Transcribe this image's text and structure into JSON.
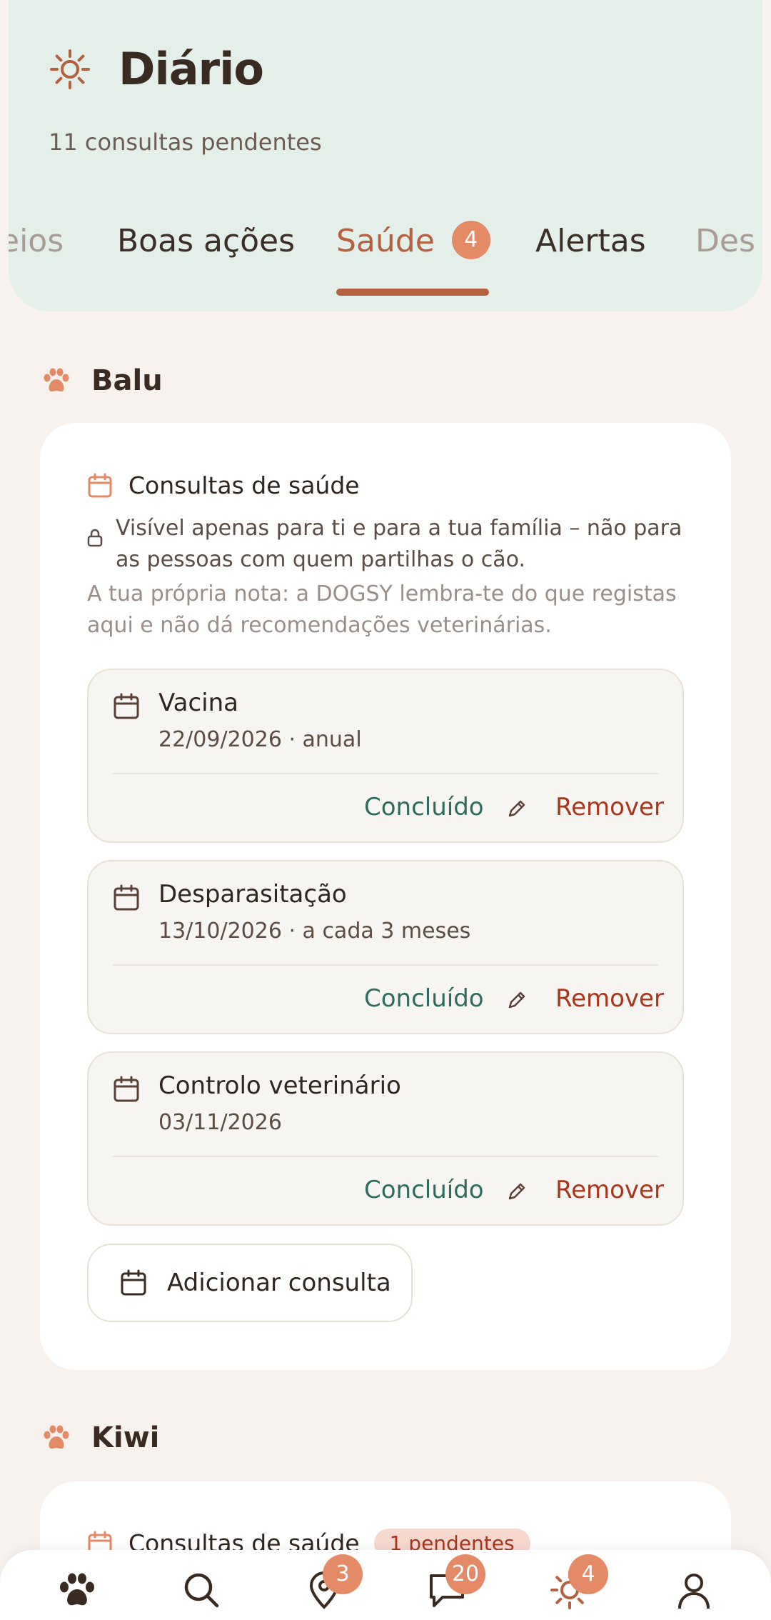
{
  "header": {
    "title": "Diário",
    "subtitle": "11 consultas pendentes",
    "tabs": [
      {
        "label": "eios"
      },
      {
        "label": "Boas ações"
      },
      {
        "label": "Saúde",
        "badge": "4"
      },
      {
        "label": "Alertas"
      },
      {
        "label": "Des"
      }
    ]
  },
  "pets": [
    {
      "name": "Balu",
      "section_title": "Consultas de saúde",
      "privacy_note": "Visível apenas para ti e para a tua família – não para as pessoas com quem partilhas o cão.",
      "disclaimer": "A tua própria nota: a DOGSY lembra-te do que registas aqui e não dá recomendações veterinárias.",
      "items": [
        {
          "name": "Vacina",
          "meta": "22/09/2026 · anual",
          "done_label": "Concluído",
          "remove_label": "Remover"
        },
        {
          "name": "Desparasitação",
          "meta": "13/10/2026 · a cada 3 meses",
          "done_label": "Concluído",
          "remove_label": "Remover"
        },
        {
          "name": "Controlo veterinário",
          "meta": "03/11/2026",
          "done_label": "Concluído",
          "remove_label": "Remover"
        }
      ],
      "add_label": "Adicionar consulta"
    },
    {
      "name": "Kiwi",
      "section_title": "Consultas de saúde",
      "pending_badge": "1 pendentes"
    }
  ],
  "bottom_nav": [
    {
      "icon": "paw-icon"
    },
    {
      "icon": "search-icon"
    },
    {
      "icon": "map-pin-icon",
      "badge": "3"
    },
    {
      "icon": "chat-icon",
      "badge": "20"
    },
    {
      "icon": "sun-icon",
      "badge": "4"
    },
    {
      "icon": "profile-icon"
    }
  ],
  "colors": {
    "accent": "#b5613f",
    "badge": "#e58a66",
    "done": "#2f6b5d",
    "remove": "#a8361d",
    "header_bg": "#e5efea",
    "page_bg": "#f8f2ee"
  }
}
